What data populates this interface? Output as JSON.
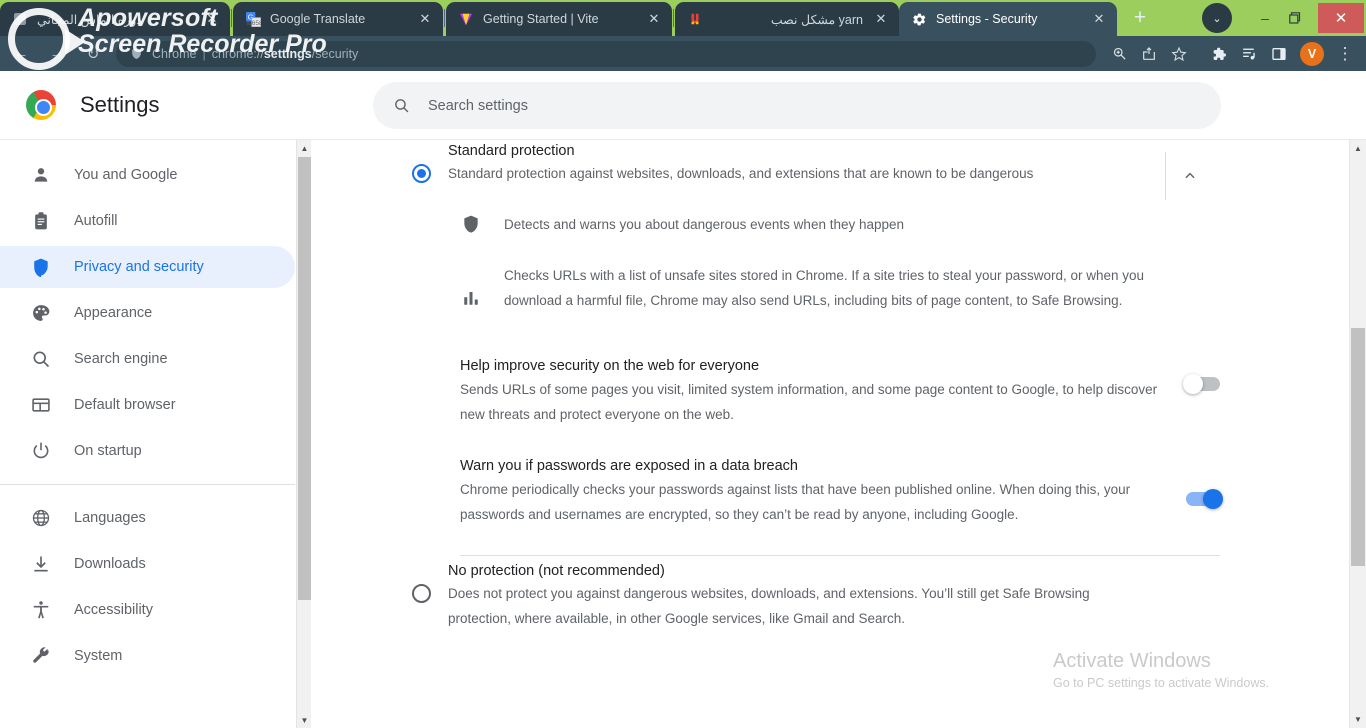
{
  "window": {
    "titlebar_color": "#9cce5e",
    "tab_strip_color": "#2b3b45",
    "active_tab_color": "#39505e",
    "controls": {
      "tab_search_label": "⌄",
      "minimize_label": "–",
      "restore_label": "❐",
      "close_label": "✕"
    }
  },
  "tabs": [
    {
      "title": "دوره الماس المجاني",
      "favicon": "generic-page-icon",
      "active": false,
      "close_label": "✕"
    },
    {
      "title": "Google Translate",
      "favicon": "google-translate-icon",
      "active": false,
      "close_label": "✕"
    },
    {
      "title": "Getting Started | Vite",
      "favicon": "vite-icon",
      "active": false,
      "close_label": "✕"
    },
    {
      "title": "مشکل نصب yarn",
      "favicon": "magnet-icon",
      "active": false,
      "close_label": "✕"
    },
    {
      "title": "Settings - Security",
      "favicon": "gear-icon",
      "active": true,
      "close_label": "✕"
    }
  ],
  "new_tab_label": "+",
  "toolbar": {
    "back_label": "←",
    "forward_label": "→",
    "reload_label": "↻",
    "omnibox": {
      "security_icon": "shield-icon",
      "host": "Chrome",
      "separator": "|",
      "path_prefix": "chrome://",
      "path_bold": "settings",
      "path_suffix": "/security",
      "full_url": "chrome://settings/security"
    },
    "icons": [
      {
        "name": "zoom-icon",
        "glyph": "⊕"
      },
      {
        "name": "share-icon",
        "glyph": "⤴"
      },
      {
        "name": "bookmark-star-icon",
        "glyph": "☆"
      },
      {
        "name": "extensions-icon",
        "glyph": "❖"
      },
      {
        "name": "reading-list-icon",
        "glyph": "☰"
      },
      {
        "name": "side-panel-icon",
        "glyph": "▣"
      }
    ],
    "avatar_initial": "V",
    "avatar_color": "#e8711a",
    "menu_label": "⋮"
  },
  "settings_header": {
    "title": "Settings",
    "logo": "chrome-logo"
  },
  "search": {
    "placeholder": "Search settings",
    "value": "",
    "icon": "search-icon"
  },
  "sidebar": {
    "items": [
      {
        "label": "You and Google",
        "icon": "person-icon",
        "active": false
      },
      {
        "label": "Autofill",
        "icon": "clipboard-icon",
        "active": false
      },
      {
        "label": "Privacy and security",
        "icon": "shield-icon",
        "active": true
      },
      {
        "label": "Appearance",
        "icon": "palette-icon",
        "active": false
      },
      {
        "label": "Search engine",
        "icon": "search-icon",
        "active": false
      },
      {
        "label": "Default browser",
        "icon": "browser-window-icon",
        "active": false
      },
      {
        "label": "On startup",
        "icon": "power-icon",
        "active": false
      }
    ],
    "items_secondary": [
      {
        "label": "Languages",
        "icon": "globe-icon",
        "active": false
      },
      {
        "label": "Downloads",
        "icon": "download-icon",
        "active": false
      },
      {
        "label": "Accessibility",
        "icon": "accessibility-icon",
        "active": false
      },
      {
        "label": "System",
        "icon": "wrench-icon",
        "active": false
      }
    ],
    "active_color": "#1a73e8",
    "active_background": "#e8f0fe"
  },
  "main": {
    "standard_protection": {
      "title": "Standard protection",
      "description": "Standard protection against websites, downloads, and extensions that are known to be dangerous",
      "selected": true,
      "expander_icon": "chevron-up-icon",
      "features": [
        {
          "icon": "shield-icon",
          "text": "Detects and warns you about dangerous events when they happen"
        },
        {
          "icon": "bar-chart-icon",
          "text": "Checks URLs with a list of unsafe sites stored in Chrome. If a site tries to steal your password, or when you download a harmful file, Chrome may also send URLs, including bits of page content, to Safe Browsing."
        }
      ],
      "toggles": [
        {
          "title": "Help improve security on the web for everyone",
          "description": "Sends URLs of some pages you visit, limited system information, and some page content to Google, to help discover new threats and protect everyone on the web.",
          "enabled": false
        },
        {
          "title": "Warn you if passwords are exposed in a data breach",
          "description": "Chrome periodically checks your passwords against lists that have been published online. When doing this, your passwords and usernames are encrypted, so they can’t be read by anyone, including Google.",
          "enabled": true
        }
      ]
    },
    "no_protection": {
      "title": "No protection (not recommended)",
      "description": "Does not protect you against dangerous websites, downloads, and extensions. You’ll still get Safe Browsing protection, where available, in other Google services, like Gmail and Search.",
      "selected": false
    }
  },
  "watermarks": {
    "apowersoft_line1": "Apowersoft",
    "apowersoft_line2": "Screen Recorder Pro",
    "windows_line1": "Activate Windows",
    "windows_line2": "Go to PC settings to activate Windows."
  },
  "scrollbars": {
    "up_arrow": "▲",
    "down_arrow": "▼"
  }
}
